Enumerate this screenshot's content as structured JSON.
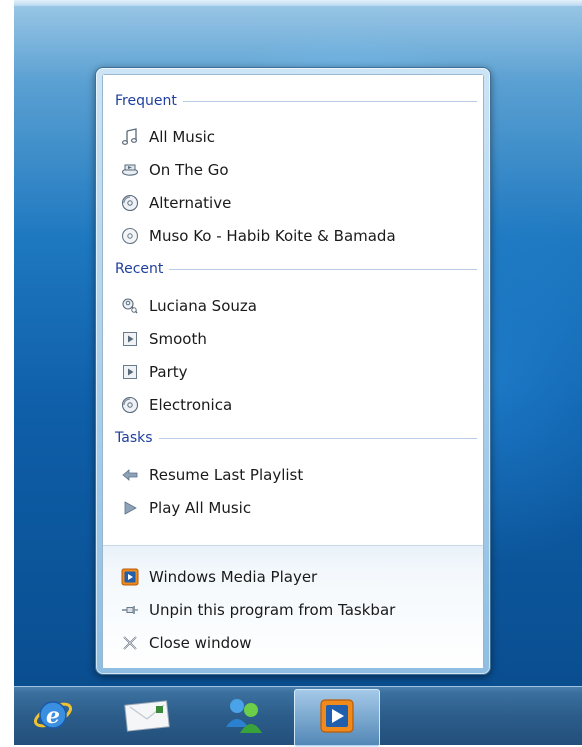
{
  "jump_list": {
    "sections": {
      "frequent": "Frequent",
      "recent": "Recent",
      "tasks": "Tasks"
    },
    "frequent": [
      {
        "label": "All Music",
        "icon": "music-note-icon"
      },
      {
        "label": "On The Go",
        "icon": "playlist-icon"
      },
      {
        "label": "Alternative",
        "icon": "genre-disc-icon"
      },
      {
        "label": "Muso Ko - Habib Koite & Bamada",
        "icon": "album-disc-icon"
      }
    ],
    "recent": [
      {
        "label": "Luciana Souza",
        "icon": "artist-icon"
      },
      {
        "label": "Smooth",
        "icon": "play-file-icon"
      },
      {
        "label": "Party",
        "icon": "play-file-icon"
      },
      {
        "label": "Electronica",
        "icon": "genre-disc-icon"
      }
    ],
    "tasks": [
      {
        "label": "Resume Last Playlist",
        "icon": "back-arrow-icon"
      },
      {
        "label": "Play All Music",
        "icon": "play-icon"
      }
    ],
    "bottom": {
      "app_name": "Windows Media Player",
      "unpin": "Unpin this program from Taskbar",
      "close": "Close window"
    }
  },
  "taskbar": {
    "apps": [
      "internet-explorer-icon",
      "mail-icon",
      "people-icon",
      "media-player-icon"
    ],
    "active": "media-player-icon"
  },
  "colors": {
    "section_heading": "#1e3f9e",
    "taskbar": "#2c5d8a"
  }
}
